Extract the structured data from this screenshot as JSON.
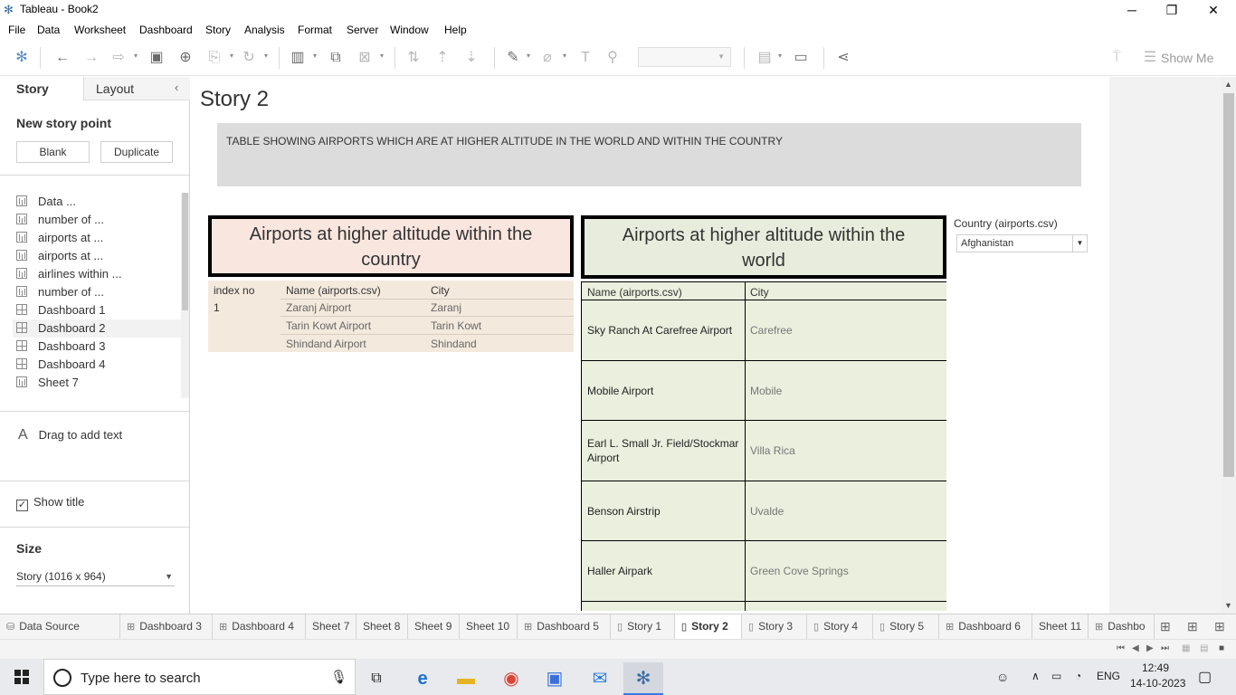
{
  "window": {
    "title": "Tableau - Book2",
    "minimize": "─",
    "maximize": "❐",
    "close": "✕"
  },
  "menu": [
    "File",
    "Data",
    "Worksheet",
    "Dashboard",
    "Story",
    "Analysis",
    "Format",
    "Server",
    "Window",
    "Help"
  ],
  "toolbar": {
    "show_me": "Show Me"
  },
  "left_panel": {
    "tab_story": "Story",
    "tab_layout": "Layout",
    "new_story_point": "New story point",
    "blank_button": "Blank",
    "duplicate_button": "Duplicate",
    "sheets": [
      {
        "label": "Data ...",
        "kind": "chart"
      },
      {
        "label": "number of ...",
        "kind": "chart"
      },
      {
        "label": "airports at ...",
        "kind": "chart"
      },
      {
        "label": "airports at ...",
        "kind": "chart"
      },
      {
        "label": "airlines within ...",
        "kind": "chart"
      },
      {
        "label": "number of ...",
        "kind": "chart"
      },
      {
        "label": "Dashboard 1",
        "kind": "dash"
      },
      {
        "label": "Dashboard 2",
        "kind": "dash"
      },
      {
        "label": "Dashboard 3",
        "kind": "dash"
      },
      {
        "label": "Dashboard 4",
        "kind": "dash"
      },
      {
        "label": "Sheet 7",
        "kind": "chart"
      }
    ],
    "drag_to_add_text": "Drag to add text",
    "show_title": "Show title",
    "size_heading": "Size",
    "size_value": "Story (1016 x 964)"
  },
  "story": {
    "title": "Story 2",
    "caption": "TABLE SHOWING AIRPORTS WHICH ARE AT HIGHER ALTITUDE IN THE WORLD AND WITHIN THE COUNTRY",
    "country_title_line1": "Airports at higher altitude within the",
    "country_title_line2": "country",
    "world_title_line1": "Airports at higher altitude within the",
    "world_title_line2": "world",
    "country_table": {
      "headers": [
        "index no",
        "Name (airports.csv)",
        "City"
      ],
      "index": "1",
      "rows": [
        {
          "name": "Zaranj Airport",
          "city": "Zaranj"
        },
        {
          "name": "Tarin Kowt Airport",
          "city": "Tarin Kowt"
        },
        {
          "name": "Shindand Airport",
          "city": "Shindand"
        }
      ]
    },
    "world_table": {
      "headers": [
        "Name (airports.csv)",
        "City"
      ],
      "rows": [
        {
          "name": "Sky Ranch At Carefree Airport",
          "city": "Carefree"
        },
        {
          "name": "Mobile Airport",
          "city": "Mobile"
        },
        {
          "name": "Earl L. Small Jr. Field/Stockmar Airport",
          "city": "Villa Rica"
        },
        {
          "name": "Benson Airstrip",
          "city": "Uvalde"
        },
        {
          "name": "Haller Airpark",
          "city": "Green Cove Springs"
        }
      ]
    },
    "filter_label": "Country (airports.csv)",
    "filter_value": "Afghanistan"
  },
  "sheet_tabs": [
    {
      "label": "Data Source",
      "icon": "db"
    },
    {
      "label": "Dashboard 3",
      "icon": "dash"
    },
    {
      "label": "Dashboard 4",
      "icon": "dash"
    },
    {
      "label": "Sheet 7",
      "icon": ""
    },
    {
      "label": "Sheet 8",
      "icon": ""
    },
    {
      "label": "Sheet 9",
      "icon": ""
    },
    {
      "label": "Sheet 10",
      "icon": ""
    },
    {
      "label": "Dashboard 5",
      "icon": "dash"
    },
    {
      "label": "Story 1",
      "icon": "story"
    },
    {
      "label": "Story 2",
      "icon": "story",
      "active": true
    },
    {
      "label": "Story 3",
      "icon": "story"
    },
    {
      "label": "Story 4",
      "icon": "story"
    },
    {
      "label": "Story 5",
      "icon": "story"
    },
    {
      "label": "Dashboard 6",
      "icon": "dash"
    },
    {
      "label": "Sheet 11",
      "icon": ""
    },
    {
      "label": "Dashbo",
      "icon": "dash"
    }
  ],
  "taskbar": {
    "search_placeholder": "Type here to search",
    "lang": "ENG",
    "time": "12:49",
    "date": "14-10-2023"
  },
  "colors": {
    "country_title_bg": "#f9e6df",
    "world_title_bg": "#e7ecdc",
    "country_table_bg": "#f4e9dd",
    "world_table_bg": "#eaefde",
    "caption_bg": "#dcdcdc"
  }
}
